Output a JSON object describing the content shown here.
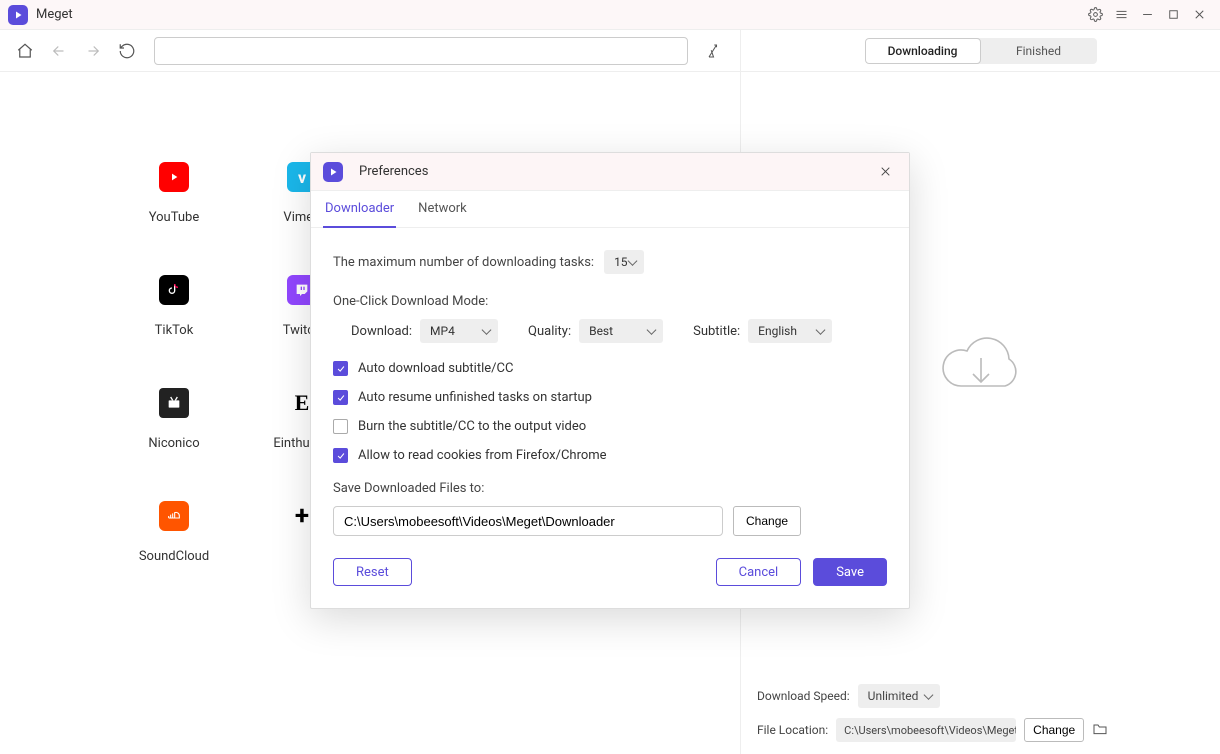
{
  "app": {
    "title": "Meget"
  },
  "tabs": {
    "downloading": "Downloading",
    "finished": "Finished"
  },
  "sites": [
    {
      "label": "YouTube"
    },
    {
      "label": "Vimeo"
    },
    {
      "label": "TikTok"
    },
    {
      "label": "Twitch"
    },
    {
      "label": "Niconico"
    },
    {
      "label": "Einthusan"
    },
    {
      "label": "SoundCloud"
    },
    {
      "label": ""
    }
  ],
  "rightFooter": {
    "speedLabel": "Download Speed:",
    "speedValue": "Unlimited",
    "locLabel": "File Location:",
    "locValue": "C:\\Users\\mobeesoft\\Videos\\Meget\\Dow",
    "change": "Change"
  },
  "prefs": {
    "title": "Preferences",
    "tabDownloader": "Downloader",
    "tabNetwork": "Network",
    "maxTasksLabel": "The maximum number of downloading tasks:",
    "maxTasksValue": "15",
    "oneClickLabel": "One-Click Download Mode:",
    "downloadLabel": "Download:",
    "downloadValue": "MP4",
    "qualityLabel": "Quality:",
    "qualityValue": "Best",
    "subtitleLabel": "Subtitle:",
    "subtitleValue": "English",
    "cbAutoSub": "Auto download subtitle/CC",
    "cbAutoResume": "Auto resume unfinished tasks on startup",
    "cbBurn": "Burn the subtitle/CC to the output video",
    "cbCookies": "Allow to read cookies from Firefox/Chrome",
    "saveToLabel": "Save Downloaded Files to:",
    "saveToValue": "C:\\Users\\mobeesoft\\Videos\\Meget\\Downloader",
    "change": "Change",
    "reset": "Reset",
    "cancel": "Cancel",
    "save": "Save"
  }
}
